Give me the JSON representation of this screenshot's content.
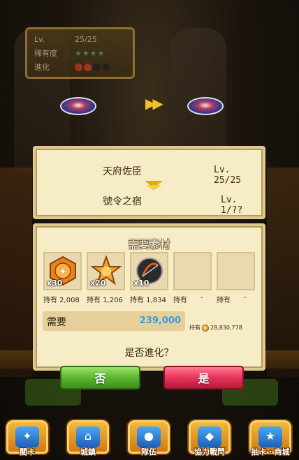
{
  "info_card": {
    "lv_label": "Lv.",
    "lv_value": "25/25",
    "rarity_label": "稀有度",
    "rarity_stars": "★★★★",
    "evolve_label": "進化",
    "evolve_orbs": [
      "#c0392b",
      "#c0392b",
      "#222222",
      "#222222"
    ]
  },
  "evolution": {
    "from_name": "天府佐臣",
    "from_level": "Lv. 25/25",
    "to_name": "號令之宿",
    "to_level": "Lv. 1/??"
  },
  "materials": {
    "title": "需要素材",
    "items": [
      {
        "icon": "orange-seal-icon",
        "count": "x30",
        "owned": "持有 2,008"
      },
      {
        "icon": "gold-star-seal-icon",
        "count": "x20",
        "owned": "持有 1,206"
      },
      {
        "icon": "black-bow-seal-icon",
        "count": "x10",
        "owned": "持有 1,834"
      },
      {
        "icon": "",
        "count": "",
        "owned": "持有"
      },
      {
        "icon": "",
        "count": "",
        "owned": "持有"
      }
    ],
    "owned_dash": "-",
    "cost_label": "需要",
    "cost_value": "239,000",
    "gold_owned_label": "持有",
    "gold_owned_value": "28,830,778",
    "question": "是否進化？"
  },
  "buttons": {
    "no_label": "否",
    "yes_label": "是"
  },
  "nav": [
    {
      "label": "關卡",
      "icon": "stage-map-icon"
    },
    {
      "label": "城鎮",
      "icon": "town-cart-icon"
    },
    {
      "label": "隊伍",
      "icon": "team-group-icon"
    },
    {
      "label": "協力戰鬥",
      "icon": "coop-battle-shield-icon"
    },
    {
      "label": "抽卡・商城",
      "icon": "gacha-star-icon"
    }
  ],
  "colors": {
    "accent_gold": "#e0c98d",
    "cost_blue": "#3a9be0",
    "btn_green": "#5cb52f",
    "btn_red": "#e7345a"
  }
}
